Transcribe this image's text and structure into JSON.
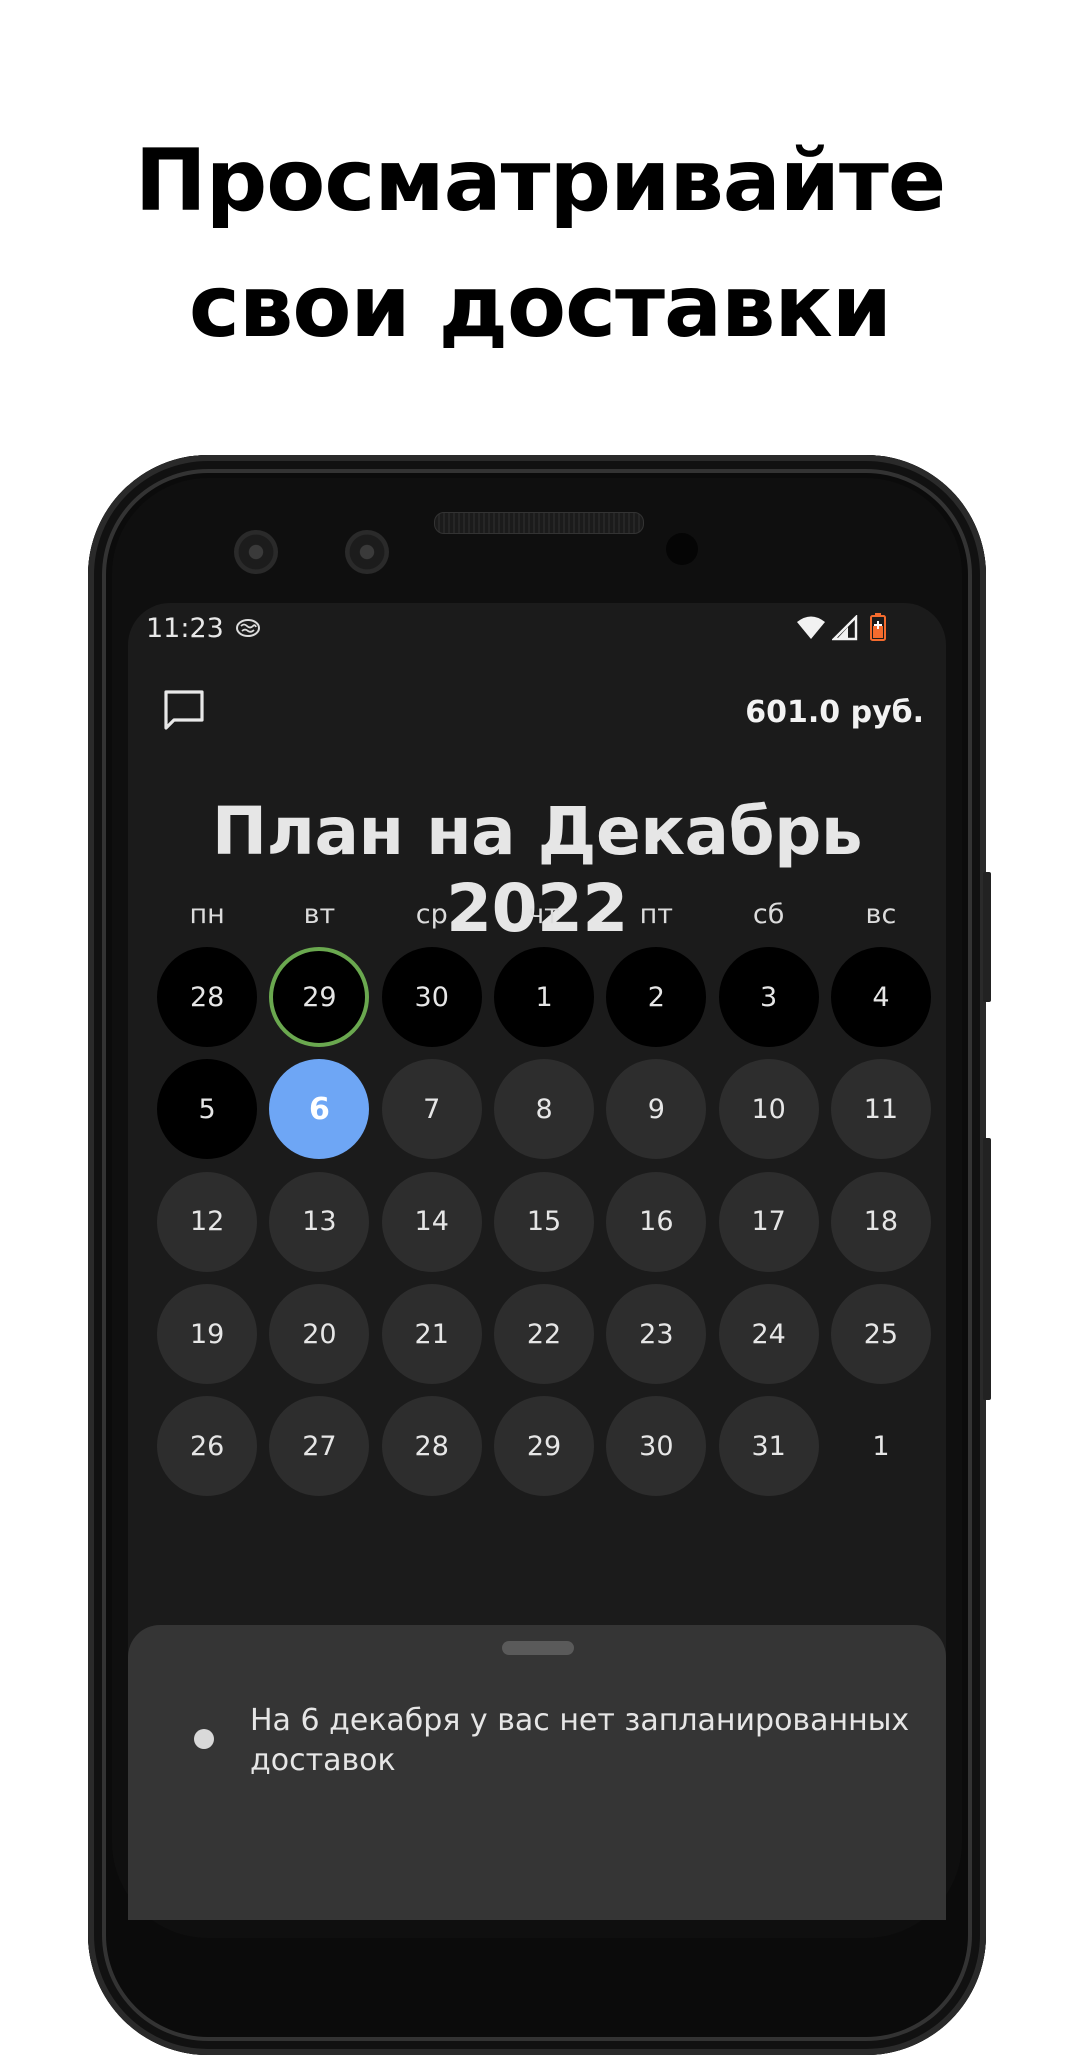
{
  "headline": {
    "line1": "Просматривайте",
    "line2": "свои доставки"
  },
  "status_bar": {
    "time": "11:23"
  },
  "app_bar": {
    "message_icon": "message-square-icon",
    "balance": "601.0 руб."
  },
  "calendar": {
    "title": "План на Декабрь 2022",
    "weekdays": [
      "пн",
      "вт",
      "ср",
      "чт",
      "пт",
      "сб",
      "вс"
    ],
    "days": [
      {
        "label": "28",
        "state": "past"
      },
      {
        "label": "29",
        "state": "today"
      },
      {
        "label": "30",
        "state": "past"
      },
      {
        "label": "1",
        "state": "past"
      },
      {
        "label": "2",
        "state": "past"
      },
      {
        "label": "3",
        "state": "past"
      },
      {
        "label": "4",
        "state": "past"
      },
      {
        "label": "5",
        "state": "past"
      },
      {
        "label": "6",
        "state": "selected"
      },
      {
        "label": "7",
        "state": "future"
      },
      {
        "label": "8",
        "state": "future"
      },
      {
        "label": "9",
        "state": "future"
      },
      {
        "label": "10",
        "state": "future"
      },
      {
        "label": "11",
        "state": "future"
      },
      {
        "label": "12",
        "state": "future"
      },
      {
        "label": "13",
        "state": "future"
      },
      {
        "label": "14",
        "state": "future"
      },
      {
        "label": "15",
        "state": "future"
      },
      {
        "label": "16",
        "state": "future"
      },
      {
        "label": "17",
        "state": "future"
      },
      {
        "label": "18",
        "state": "future"
      },
      {
        "label": "19",
        "state": "future"
      },
      {
        "label": "20",
        "state": "future"
      },
      {
        "label": "21",
        "state": "future"
      },
      {
        "label": "22",
        "state": "future"
      },
      {
        "label": "23",
        "state": "future"
      },
      {
        "label": "24",
        "state": "future"
      },
      {
        "label": "25",
        "state": "future"
      },
      {
        "label": "26",
        "state": "future"
      },
      {
        "label": "27",
        "state": "future"
      },
      {
        "label": "28",
        "state": "future"
      },
      {
        "label": "29",
        "state": "future"
      },
      {
        "label": "30",
        "state": "future"
      },
      {
        "label": "31",
        "state": "future"
      },
      {
        "label": "1",
        "state": "other"
      }
    ],
    "colors": {
      "past": "#000000",
      "future": "#2d2d2d",
      "selected": "#6ea6f5",
      "today_ring": "#6aa84f"
    }
  },
  "sheet": {
    "message": "На 6 декабря у вас нет запланированных доставок"
  }
}
